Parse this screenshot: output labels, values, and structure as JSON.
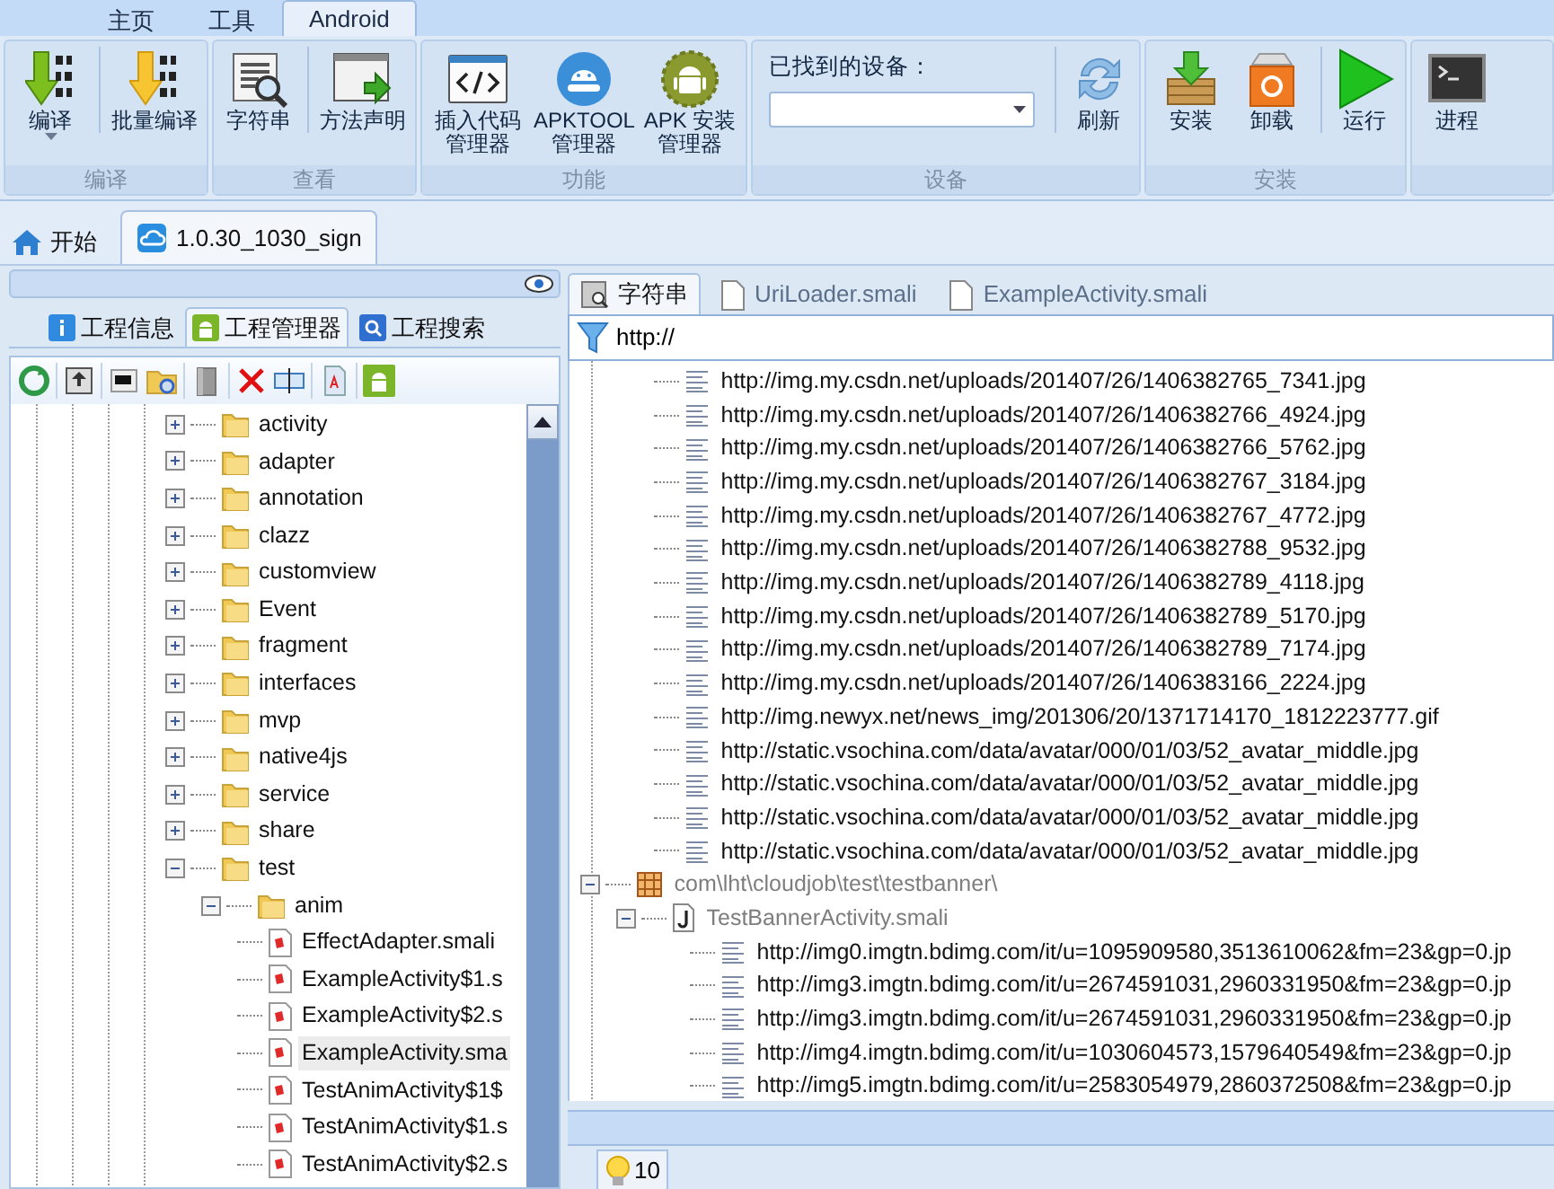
{
  "ribbon_tabs": [
    {
      "label": "主页",
      "selected": false
    },
    {
      "label": "工具",
      "selected": false
    },
    {
      "label": "Android",
      "selected": true
    }
  ],
  "ribbon_groups": [
    {
      "label": "编译",
      "buttons": [
        {
          "kind": "compile",
          "label": "编译",
          "dropdown": true,
          "divider_before": false
        },
        {
          "kind": "batch",
          "label": "批量编译",
          "dropdown": false,
          "divider_before": true
        }
      ]
    },
    {
      "label": "查看",
      "buttons": [
        {
          "kind": "strings",
          "label": "字符串",
          "dropdown": false,
          "divider_before": false
        },
        {
          "kind": "method",
          "label": "方法声明",
          "dropdown": false,
          "divider_before": true
        }
      ]
    },
    {
      "label": "功能",
      "buttons": [
        {
          "kind": "code",
          "label": "插入代码管理器",
          "dropdown": false,
          "divider_before": false
        },
        {
          "kind": "apktool",
          "label": "APKTOOL 管理器",
          "dropdown": false,
          "divider_before": false
        },
        {
          "kind": "apkinstall",
          "label": "APK 安装管理器",
          "dropdown": false,
          "divider_before": false
        }
      ]
    },
    {
      "label": "设备",
      "device_label": "已找到的设备：",
      "buttons": [
        {
          "kind": "refresh",
          "label": "刷新",
          "dropdown": false,
          "divider_before": true
        }
      ]
    },
    {
      "label": "安装",
      "buttons": [
        {
          "kind": "install",
          "label": "安装",
          "dropdown": false,
          "divider_before": false
        },
        {
          "kind": "uninstall",
          "label": "卸载",
          "dropdown": false,
          "divider_before": false
        },
        {
          "kind": "run",
          "label": "运行",
          "dropdown": false,
          "divider_before": true
        }
      ]
    },
    {
      "buttons": [
        {
          "kind": "process",
          "label": "进程",
          "dropdown": false,
          "divider_before": false
        }
      ]
    }
  ],
  "document_tabs": [
    {
      "kind": "home",
      "label": "开始",
      "selected": false
    },
    {
      "kind": "project",
      "label": "1.0.30_1030_sign",
      "selected": true
    }
  ],
  "left_panel": {
    "tabs": [
      {
        "kind": "info",
        "label": "工程信息",
        "selected": false
      },
      {
        "kind": "android",
        "label": "工程管理器",
        "selected": true
      },
      {
        "kind": "search",
        "label": "工程搜索",
        "selected": false
      }
    ],
    "tree": [
      {
        "kind": "folder",
        "label": "activity",
        "expanded": false
      },
      {
        "kind": "folder",
        "label": "adapter",
        "expanded": false
      },
      {
        "kind": "folder",
        "label": "annotation",
        "expanded": false
      },
      {
        "kind": "folder",
        "label": "clazz",
        "expanded": false
      },
      {
        "kind": "folder",
        "label": "customview",
        "expanded": false
      },
      {
        "kind": "folder",
        "label": "Event",
        "expanded": false
      },
      {
        "kind": "folder",
        "label": "fragment",
        "expanded": false
      },
      {
        "kind": "folder",
        "label": "interfaces",
        "expanded": false
      },
      {
        "kind": "folder",
        "label": "mvp",
        "expanded": false
      },
      {
        "kind": "folder",
        "label": "native4js",
        "expanded": false
      },
      {
        "kind": "folder",
        "label": "service",
        "expanded": false
      },
      {
        "kind": "folder",
        "label": "share",
        "expanded": false
      },
      {
        "kind": "folder",
        "label": "test",
        "expanded": true,
        "children": [
          {
            "kind": "folder",
            "label": "anim",
            "expanded": true,
            "children": [
              {
                "kind": "file",
                "label": "EffectAdapter.smali",
                "selected": false
              },
              {
                "kind": "file",
                "label": "ExampleActivity$1.s",
                "selected": false
              },
              {
                "kind": "file",
                "label": "ExampleActivity$2.s",
                "selected": false
              },
              {
                "kind": "file",
                "label": "ExampleActivity.sma",
                "selected": true
              },
              {
                "kind": "file",
                "label": "TestAnimActivity$1$",
                "selected": false
              },
              {
                "kind": "file",
                "label": "TestAnimActivity$1.s",
                "selected": false
              },
              {
                "kind": "file",
                "label": "TestAnimActivity$2.s",
                "selected": false
              }
            ]
          }
        ]
      }
    ]
  },
  "right_panel": {
    "tabs": [
      {
        "kind": "strings",
        "label": "字符串",
        "selected": true
      },
      {
        "kind": "file",
        "label": "UriLoader.smali",
        "selected": false
      },
      {
        "kind": "file",
        "label": "ExampleActivity.smali",
        "selected": false
      }
    ],
    "filter": {
      "value": "http://"
    },
    "results": [
      {
        "kind": "string",
        "label": "http://img.my.csdn.net/uploads/201407/26/1406382765_7341.jpg"
      },
      {
        "kind": "string",
        "label": "http://img.my.csdn.net/uploads/201407/26/1406382766_4924.jpg"
      },
      {
        "kind": "string",
        "label": "http://img.my.csdn.net/uploads/201407/26/1406382766_5762.jpg"
      },
      {
        "kind": "string",
        "label": "http://img.my.csdn.net/uploads/201407/26/1406382767_3184.jpg"
      },
      {
        "kind": "string",
        "label": "http://img.my.csdn.net/uploads/201407/26/1406382767_4772.jpg"
      },
      {
        "kind": "string",
        "label": "http://img.my.csdn.net/uploads/201407/26/1406382788_9532.jpg"
      },
      {
        "kind": "string",
        "label": "http://img.my.csdn.net/uploads/201407/26/1406382789_4118.jpg"
      },
      {
        "kind": "string",
        "label": "http://img.my.csdn.net/uploads/201407/26/1406382789_5170.jpg"
      },
      {
        "kind": "string",
        "label": "http://img.my.csdn.net/uploads/201407/26/1406382789_7174.jpg"
      },
      {
        "kind": "string",
        "label": "http://img.my.csdn.net/uploads/201407/26/1406383166_2224.jpg"
      },
      {
        "kind": "string",
        "label": "http://img.newyx.net/news_img/201306/20/1371714170_1812223777.gif"
      },
      {
        "kind": "string",
        "label": "http://static.vsochina.com/data/avatar/000/01/03/52_avatar_middle.jpg"
      },
      {
        "kind": "string",
        "label": "http://static.vsochina.com/data/avatar/000/01/03/52_avatar_middle.jpg"
      },
      {
        "kind": "string",
        "label": "http://static.vsochina.com/data/avatar/000/01/03/52_avatar_middle.jpg"
      },
      {
        "kind": "string",
        "label": "http://static.vsochina.com/data/avatar/000/01/03/52_avatar_middle.jpg"
      },
      {
        "kind": "package",
        "label": "com\\lht\\cloudjob\\test\\testbanner\\",
        "expanded": true,
        "children": [
          {
            "kind": "smali",
            "label": "TestBannerActivity.smali",
            "expanded": true,
            "children": [
              {
                "kind": "string",
                "label": "http://img0.imgtn.bdimg.com/it/u=1095909580,3513610062&fm=23&gp=0.jp"
              },
              {
                "kind": "string",
                "label": "http://img3.imgtn.bdimg.com/it/u=2674591031,2960331950&fm=23&gp=0.jp"
              },
              {
                "kind": "string",
                "label": "http://img3.imgtn.bdimg.com/it/u=2674591031,2960331950&fm=23&gp=0.jp"
              },
              {
                "kind": "string",
                "label": "http://img4.imgtn.bdimg.com/it/u=1030604573,1579640549&fm=23&gp=0.jp"
              },
              {
                "kind": "string",
                "label": "http://img5.imgtn.bdimg.com/it/u=2583054979,2860372508&fm=23&gp=0.jp"
              }
            ]
          }
        ]
      }
    ]
  },
  "status_bar": {
    "tabs": [
      {
        "kind": "tips",
        "label": "10",
        "selected": true
      }
    ]
  }
}
